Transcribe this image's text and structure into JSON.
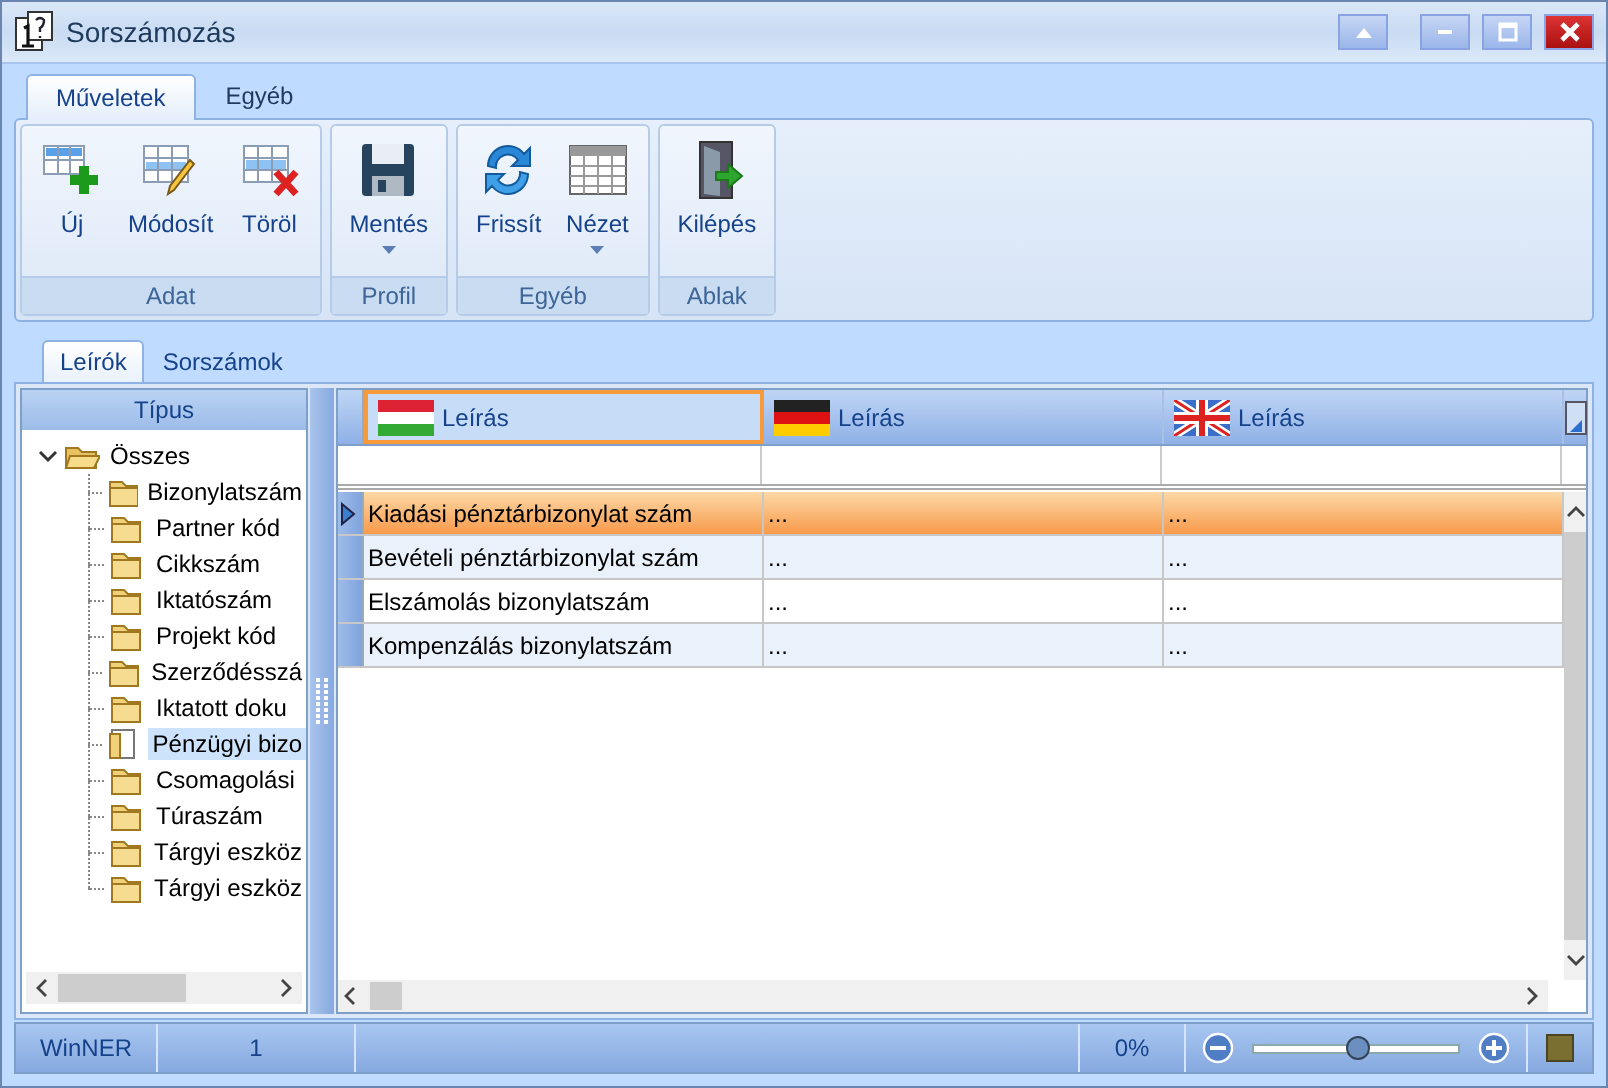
{
  "window": {
    "title": "Sorszámozás"
  },
  "ribbon": {
    "tabs": [
      {
        "label": "Műveletek",
        "selected": true
      },
      {
        "label": "Egyéb",
        "selected": false
      }
    ],
    "groups": [
      {
        "label": "Adat",
        "buttons": [
          {
            "label": "Új",
            "dropdown": false
          },
          {
            "label": "Módosít",
            "dropdown": false
          },
          {
            "label": "Töröl",
            "dropdown": false
          }
        ]
      },
      {
        "label": "Profil",
        "buttons": [
          {
            "label": "Mentés",
            "dropdown": true
          }
        ]
      },
      {
        "label": "Egyéb",
        "buttons": [
          {
            "label": "Frissít",
            "dropdown": false
          },
          {
            "label": "Nézet",
            "dropdown": true
          }
        ]
      },
      {
        "label": "Ablak",
        "buttons": [
          {
            "label": "Kilépés",
            "dropdown": false
          }
        ]
      }
    ]
  },
  "doc_tabs": [
    {
      "label": "Leírók",
      "selected": true
    },
    {
      "label": "Sorszámok",
      "selected": false
    }
  ],
  "tree": {
    "header": "Típus",
    "root": {
      "label": "Összes",
      "expanded": true,
      "selected": false,
      "children": [
        {
          "label": "Bizonylatszám",
          "selected": false
        },
        {
          "label": "Partner kód",
          "selected": false
        },
        {
          "label": "Cikkszám",
          "selected": false
        },
        {
          "label": "Iktatószám",
          "selected": false
        },
        {
          "label": "Projekt kód",
          "selected": false
        },
        {
          "label": "Szerződésszá",
          "selected": false
        },
        {
          "label": "Iktatott doku",
          "selected": false
        },
        {
          "label": "Pénzügyi bizo",
          "selected": true
        },
        {
          "label": "Csomagolási",
          "selected": false
        },
        {
          "label": "Túraszám",
          "selected": false
        },
        {
          "label": "Tárgyi eszköz",
          "selected": false
        },
        {
          "label": "Tárgyi eszköz",
          "selected": false
        }
      ]
    }
  },
  "grid": {
    "columns": [
      {
        "label": "Leírás",
        "selected": true
      },
      {
        "label": "Leírás",
        "selected": false
      },
      {
        "label": "Leírás",
        "selected": false
      }
    ],
    "rows": [
      {
        "cells": [
          "Kiadási pénztárbizonylat szám",
          "...",
          "..."
        ],
        "selected": true
      },
      {
        "cells": [
          "Bevételi pénztárbizonylat szám",
          "...",
          "..."
        ],
        "selected": false
      },
      {
        "cells": [
          "Elszámolás bizonylatszám",
          "...",
          "..."
        ],
        "selected": false
      },
      {
        "cells": [
          "Kompenzálás bizonylatszám",
          "...",
          "..."
        ],
        "selected": false
      }
    ]
  },
  "status_bar": {
    "app": "WinNER",
    "count": "1",
    "zoom_text": "0%",
    "zoom": {
      "level": 0.5
    }
  }
}
